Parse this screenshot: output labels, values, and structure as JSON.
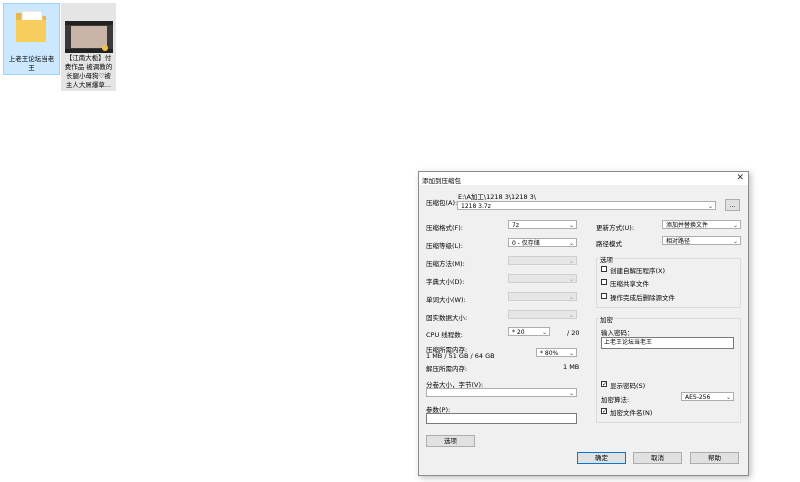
{
  "desktop": {
    "icons": [
      {
        "label": "上老王论坛当老王",
        "type": "folder"
      },
      {
        "label": "【江南大栀】付费作品 被调教的长腿小母狗♡被主人大屌爆草...",
        "type": "video"
      }
    ]
  },
  "dialog": {
    "title": "添加到压缩包",
    "close_glyph": "✕",
    "archive_label": "压缩包(A):",
    "archive_path": "E:\\A加工\\1218 3\\1218 3\\",
    "archive_name": "1218 3.7z",
    "browse_label": "...",
    "left": {
      "format_label": "压缩格式(F):",
      "format_value": "7z",
      "level_label": "压缩等级(L):",
      "level_value": "0 - 仅存储",
      "method_label": "压缩方法(M):",
      "method_value": "",
      "dict_label": "字典大小(D):",
      "dict_value": "",
      "word_label": "单词大小(W):",
      "word_value": "",
      "solid_label": "固实数据大小:",
      "solid_value": "",
      "cpu_label": "CPU 线程数:",
      "cpu_value": "* 20",
      "cpu_max": "/ 20",
      "mem_label": "压缩所需内存:",
      "mem_value": "1 MB / 51 GB / 64 GB",
      "mem_pct": "* 80%",
      "decomp_label": "解压所需内存:",
      "decomp_value": "1 MB",
      "split_label": "分卷大小，字节(V):",
      "split_value": "",
      "params_label": "参数(P):",
      "params_value": "",
      "options_button": "选项"
    },
    "right": {
      "update_label": "更新方式(U):",
      "update_value": "添加并替换文件",
      "path_label": "路径模式",
      "path_value": "相对路径",
      "options_group": "选项",
      "opt_sfx": "创建自解压程序(X)",
      "opt_shared": "压缩共享文件",
      "opt_delete": "操作完成后删除源文件",
      "encrypt_group": "加密",
      "password_label": "输入密码：",
      "password_value": "上老王论坛当老王",
      "show_password": "显示密码(S)",
      "encrypt_method_label": "加密算法:",
      "encrypt_method_value": "AES-256",
      "encrypt_names": "加密文件名(N)"
    },
    "buttons": {
      "ok": "确定",
      "cancel": "取消",
      "help": "帮助"
    }
  }
}
